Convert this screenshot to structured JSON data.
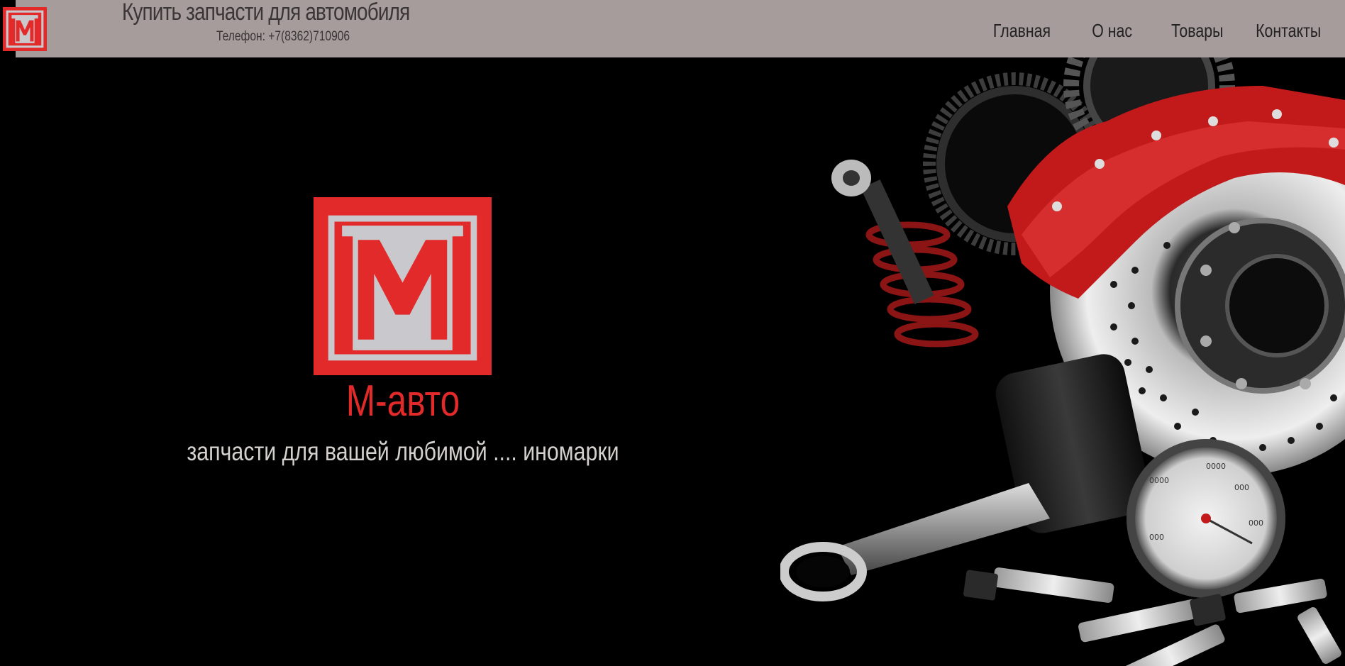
{
  "header": {
    "title": "Купить запчасти для автомобиля",
    "phone": "Телефон: +7(8362)710906",
    "logo_icon": "m-logo-icon"
  },
  "nav": {
    "items": [
      {
        "label": "Главная"
      },
      {
        "label": "О нас"
      },
      {
        "label": "Товары"
      },
      {
        "label": "Контакты"
      }
    ]
  },
  "hero": {
    "logo_icon": "m-logo-icon",
    "brand": "М-авто",
    "tagline": "запчасти для вашей любимой .... иномарки",
    "image": "auto-parts-image"
  },
  "colors": {
    "header_bg": "#a69c9b",
    "brand_red": "#e22a2a",
    "page_bg": "#000000",
    "logo_inner": "#c9c8cc"
  }
}
